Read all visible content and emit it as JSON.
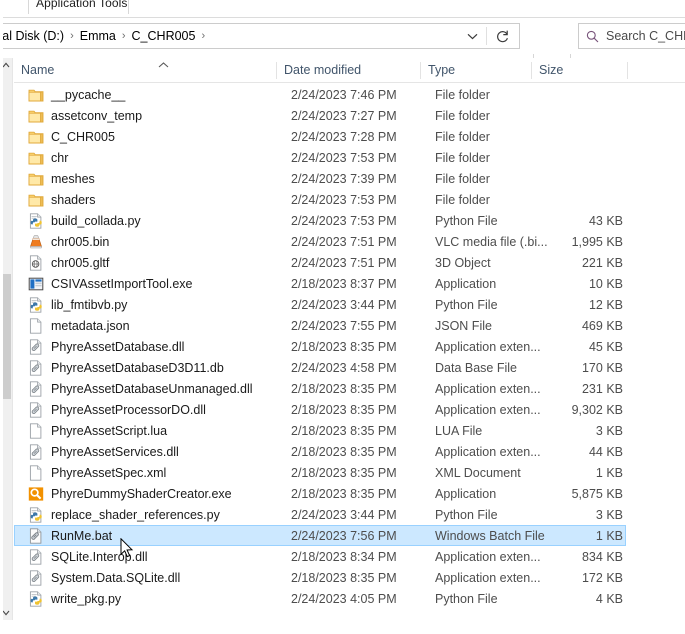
{
  "ribbon": {
    "tab_label": "Application Tools"
  },
  "addressbar": {
    "breadcrumbs": [
      "cal Disk (D:)",
      "Emma",
      "C_CHR005"
    ],
    "separator": "›",
    "dropdown_icon": "chevron-down-icon",
    "refresh_icon": "refresh-icon",
    "refresh_glyph": "↻",
    "caret_glyph": "⌄"
  },
  "search": {
    "icon": "search-icon",
    "text": "Search C_CHR"
  },
  "columns": {
    "name": "Name",
    "date_modified": "Date modified",
    "type": "Type",
    "size": "Size",
    "sort_caret": "⌃"
  },
  "scrollbar": {
    "up_glyph": "∧",
    "down_glyph": "∨"
  },
  "files": [
    {
      "name": "__pycache__",
      "icon": "folder-icon",
      "date": "2/24/2023 7:46 PM",
      "type": "File folder",
      "size": ""
    },
    {
      "name": "assetconv_temp",
      "icon": "folder-icon",
      "date": "2/24/2023 7:27 PM",
      "type": "File folder",
      "size": ""
    },
    {
      "name": "C_CHR005",
      "icon": "folder-icon",
      "date": "2/24/2023 7:28 PM",
      "type": "File folder",
      "size": ""
    },
    {
      "name": "chr",
      "icon": "folder-icon",
      "date": "2/24/2023 7:53 PM",
      "type": "File folder",
      "size": ""
    },
    {
      "name": "meshes",
      "icon": "folder-icon",
      "date": "2/24/2023 7:39 PM",
      "type": "File folder",
      "size": ""
    },
    {
      "name": "shaders",
      "icon": "folder-icon",
      "date": "2/24/2023 7:53 PM",
      "type": "File folder",
      "size": ""
    },
    {
      "name": "build_collada.py",
      "icon": "python-file-icon",
      "date": "2/24/2023 7:53 PM",
      "type": "Python File",
      "size": "43 KB"
    },
    {
      "name": "chr005.bin",
      "icon": "vlc-cone-icon",
      "date": "2/24/2023 7:51 PM",
      "type": "VLC media file (.bi...",
      "size": "1,995 KB"
    },
    {
      "name": "chr005.gltf",
      "icon": "3d-object-icon",
      "date": "2/24/2023 7:51 PM",
      "type": "3D Object",
      "size": "221 KB"
    },
    {
      "name": "CSIVAssetImportTool.exe",
      "icon": "application-icon",
      "date": "2/18/2023 8:37 PM",
      "type": "Application",
      "size": "10 KB"
    },
    {
      "name": "lib_fmtibvb.py",
      "icon": "python-file-icon",
      "date": "2/24/2023 3:44 PM",
      "type": "Python File",
      "size": "12 KB"
    },
    {
      "name": "metadata.json",
      "icon": "blank-file-icon",
      "date": "2/24/2023 7:55 PM",
      "type": "JSON File",
      "size": "469 KB"
    },
    {
      "name": "PhyreAssetDatabase.dll",
      "icon": "dll-file-icon",
      "date": "2/18/2023 8:35 PM",
      "type": "Application exten...",
      "size": "45 KB"
    },
    {
      "name": "PhyreAssetDatabaseD3D11.db",
      "icon": "dll-file-icon",
      "date": "2/24/2023 4:58 PM",
      "type": "Data Base File",
      "size": "170 KB"
    },
    {
      "name": "PhyreAssetDatabaseUnmanaged.dll",
      "icon": "dll-file-icon",
      "date": "2/18/2023 8:35 PM",
      "type": "Application exten...",
      "size": "231 KB"
    },
    {
      "name": "PhyreAssetProcessorDO.dll",
      "icon": "dll-file-icon",
      "date": "2/18/2023 8:35 PM",
      "type": "Application exten...",
      "size": "9,302 KB"
    },
    {
      "name": "PhyreAssetScript.lua",
      "icon": "blank-file-icon",
      "date": "2/18/2023 8:35 PM",
      "type": "LUA File",
      "size": "3 KB"
    },
    {
      "name": "PhyreAssetServices.dll",
      "icon": "dll-file-icon",
      "date": "2/18/2023 8:35 PM",
      "type": "Application exten...",
      "size": "44 KB"
    },
    {
      "name": "PhyreAssetSpec.xml",
      "icon": "blank-file-icon",
      "date": "2/18/2023 8:35 PM",
      "type": "XML Document",
      "size": "1 KB"
    },
    {
      "name": "PhyreDummyShaderCreator.exe",
      "icon": "magnifier-app-icon",
      "date": "2/18/2023 8:35 PM",
      "type": "Application",
      "size": "5,875 KB"
    },
    {
      "name": "replace_shader_references.py",
      "icon": "python-file-icon",
      "date": "2/24/2023 3:44 PM",
      "type": "Python File",
      "size": "3 KB"
    },
    {
      "name": "RunMe.bat",
      "icon": "batch-file-icon",
      "date": "2/24/2023 7:56 PM",
      "type": "Windows Batch File",
      "size": "1 KB",
      "selected": true
    },
    {
      "name": "SQLite.Interop.dll",
      "icon": "dll-file-icon",
      "date": "2/18/2023 8:34 PM",
      "type": "Application exten...",
      "size": "834 KB"
    },
    {
      "name": "System.Data.SQLite.dll",
      "icon": "dll-file-icon",
      "date": "2/18/2023 8:35 PM",
      "type": "Application exten...",
      "size": "172 KB"
    },
    {
      "name": "write_pkg.py",
      "icon": "python-file-icon",
      "date": "2/24/2023 4:05 PM",
      "type": "Python File",
      "size": "4 KB"
    }
  ],
  "colors": {
    "selection_fill": "#cce8ff",
    "selection_border": "#99d1ff",
    "header_text": "#41556b",
    "folder_yellow": "#ffd866"
  }
}
